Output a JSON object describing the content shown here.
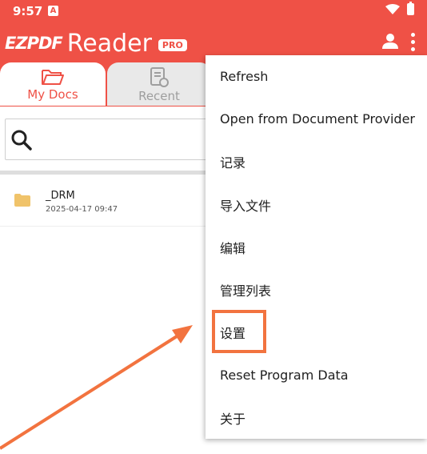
{
  "status_bar": {
    "time": "9:57",
    "notification_icon": "A"
  },
  "app": {
    "logo_ez": "EZPDF",
    "logo_reader": "Reader",
    "badge": "PRO"
  },
  "tabs": [
    {
      "label": "My Docs",
      "icon": "folder-open-icon",
      "selected": true
    },
    {
      "label": "Recent",
      "icon": "recent-doc-icon",
      "selected": false
    }
  ],
  "search": {
    "placeholder": ""
  },
  "files": [
    {
      "name": "_DRM",
      "date": "2025-04-17 09:47",
      "icon": "folder-icon"
    }
  ],
  "menu": {
    "items": [
      "Refresh",
      "Open from Document Provider",
      "记录",
      "导入文件",
      "编辑",
      "管理列表",
      "设置",
      "Reset Program Data",
      "关于"
    ],
    "highlighted_index": 6
  },
  "colors": {
    "accent": "#ef5146",
    "annotation": "#f2733f",
    "folder": "#f0c36a"
  }
}
